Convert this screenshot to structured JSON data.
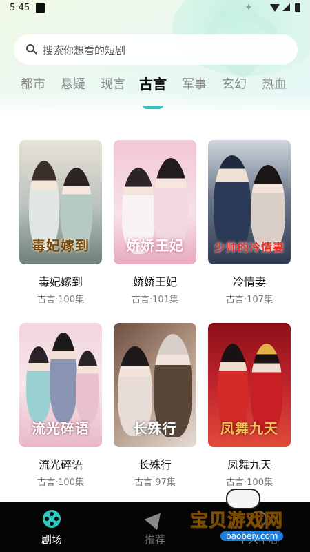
{
  "status_bar": {
    "time": "5:45"
  },
  "search": {
    "placeholder": "搜索你想看的短剧"
  },
  "tabs": [
    {
      "label": "都市"
    },
    {
      "label": "悬疑"
    },
    {
      "label": "现言"
    },
    {
      "label": "古言",
      "active": true
    },
    {
      "label": "军事"
    },
    {
      "label": "玄幻"
    },
    {
      "label": "热血"
    }
  ],
  "dramas": [
    {
      "title": "毒妃嫁到",
      "meta": "古言·100集",
      "poster_text": "毒妃嫁到",
      "colors": [
        "#e8e1d6",
        "#a9b4b0"
      ]
    },
    {
      "title": "娇娇王妃",
      "meta": "古言·101集",
      "poster_text": "娇娇王妃",
      "colors": [
        "#f4c9d6",
        "#e7a7bd"
      ]
    },
    {
      "title": "冷情妻",
      "meta": "古言·107集",
      "poster_text": "少帅的冷情妻",
      "colors": [
        "#3d4766",
        "#c7b9a8"
      ]
    },
    {
      "title": "流光碎语",
      "meta": "古言·100集",
      "poster_text": "流光碎语",
      "colors": [
        "#f3cfd7",
        "#e8b4c3"
      ]
    },
    {
      "title": "长殊行",
      "meta": "古言·97集",
      "poster_text": "长殊行",
      "colors": [
        "#7d5c4c",
        "#dccfc4"
      ]
    },
    {
      "title": "凤舞九天",
      "meta": "古言·100集",
      "poster_text": "凤舞九天",
      "colors": [
        "#b0202a",
        "#e0473d"
      ]
    }
  ],
  "bottom_nav": [
    {
      "label": "剧场",
      "icon": "film-reel-icon",
      "active": true
    },
    {
      "label": "推荐",
      "icon": "send-icon"
    },
    {
      "label": "个人中心",
      "icon": "user-icon"
    }
  ],
  "watermark": {
    "text": "宝贝游戏网",
    "url": "baobeiy.com"
  },
  "colors": {
    "accent": "#2dc8c0",
    "nav_bg": "#050505"
  }
}
